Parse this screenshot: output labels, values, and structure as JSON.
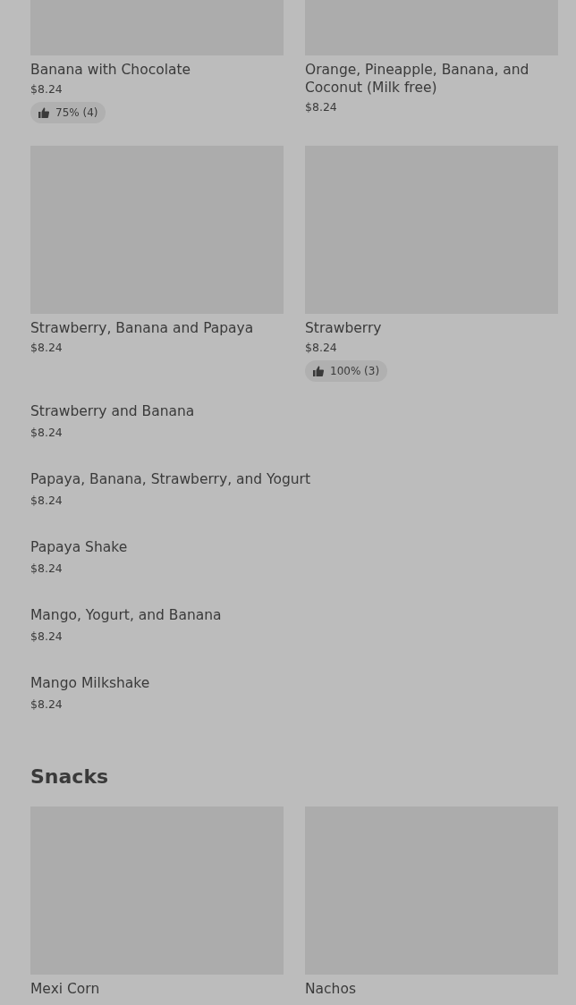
{
  "sections": [
    {
      "items": [
        {
          "kind": "card",
          "name": "Banana with Chocolate",
          "price": "$8.24",
          "rating": "75% (4)"
        },
        {
          "kind": "card",
          "name": "Orange, Pineapple, Banana, and Coconut (Milk free)",
          "price": "$8.24"
        },
        {
          "kind": "card",
          "name": "Strawberry, Banana and Papaya",
          "price": "$8.24"
        },
        {
          "kind": "card",
          "name": "Strawberry",
          "price": "$8.24",
          "rating": "100% (3)"
        },
        {
          "kind": "row",
          "name": "Strawberry and Banana",
          "price": "$8.24"
        },
        {
          "kind": "row",
          "name": "Papaya, Banana, Strawberry, and Yogurt",
          "price": "$8.24"
        },
        {
          "kind": "row",
          "name": "Papaya Shake",
          "price": "$8.24"
        },
        {
          "kind": "row",
          "name": "Mango, Yogurt, and Banana",
          "price": "$8.24"
        },
        {
          "kind": "row",
          "name": "Mango Milkshake",
          "price": "$8.24"
        }
      ]
    },
    {
      "title": "Snacks",
      "items": [
        {
          "kind": "card",
          "name": "Mexi Corn"
        },
        {
          "kind": "card",
          "name": "Nachos"
        }
      ]
    }
  ]
}
